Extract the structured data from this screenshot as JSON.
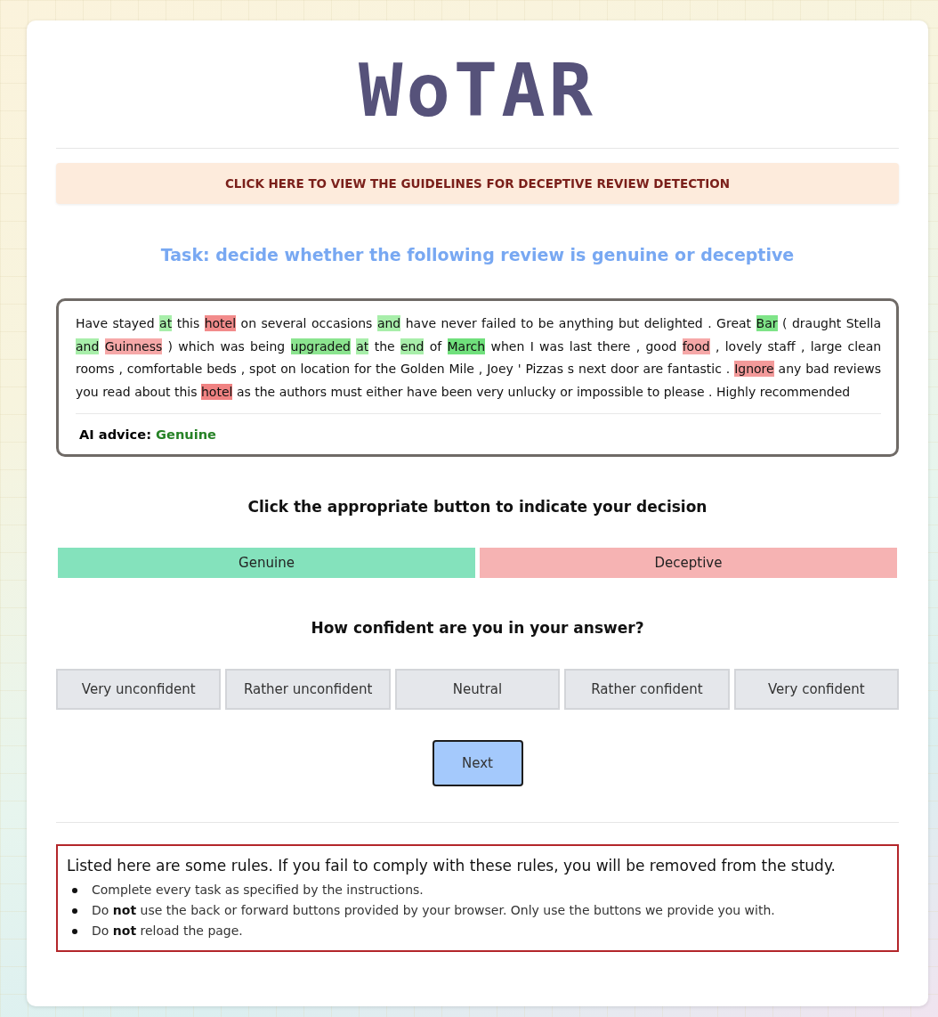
{
  "logo": "WoTAR",
  "guidelines_link": "CLICK HERE TO VIEW THE GUIDELINES FOR DECEPTIVE REVIEW DETECTION",
  "task_heading": "Task: decide whether the following review is genuine or deceptive",
  "review": {
    "segments": [
      {
        "text": "Have stayed"
      },
      {
        "text": "at",
        "color": "#a8eeaa"
      },
      {
        "text": "this"
      },
      {
        "text": "hotel",
        "color": "#f28b8b"
      },
      {
        "text": "on several occasions"
      },
      {
        "text": "and",
        "color": "#a8eeaa"
      },
      {
        "text": "have never failed to be anything but delighted . Great"
      },
      {
        "text": "Bar",
        "color": "#7fe488"
      },
      {
        "text": "( draught Stella"
      },
      {
        "text": "and",
        "color": "#a8eeaa"
      },
      {
        "text": "Guinness",
        "color": "#f6a8a8"
      },
      {
        "text": ") which was being"
      },
      {
        "text": "upgraded",
        "color": "#8be48f"
      },
      {
        "text": "at",
        "color": "#a8eeaa"
      },
      {
        "text": "the"
      },
      {
        "text": "end",
        "color": "#a8eeaa"
      },
      {
        "text": "of"
      },
      {
        "text": "March",
        "color": "#70e07c"
      },
      {
        "text": "when I was last there , good"
      },
      {
        "text": "food",
        "color": "#f6a8a8"
      },
      {
        "text": ", lovely staff , large clean rooms , comfortable beds , spot on location for the Golden Mile , Joey ' Pizzas s next door are fantastic ."
      },
      {
        "text": "Ignore",
        "color": "#f39a9a"
      },
      {
        "text": "any bad reviews you read about this"
      },
      {
        "text": "hotel",
        "color": "#f08282"
      },
      {
        "text": "as the authors must either have been very unlucky or impossible to please . Highly recommended"
      }
    ],
    "advice_label": "AI advice:",
    "advice_value": "Genuine"
  },
  "decision_heading": "Click the appropriate button to indicate your decision",
  "decision_buttons": [
    {
      "label": "Genuine",
      "kind": "genuine"
    },
    {
      "label": "Deceptive",
      "kind": "deceptive"
    }
  ],
  "confidence_heading": "How confident are you in your answer?",
  "confidence_options": [
    {
      "label": "Very unconfident",
      "selected": false
    },
    {
      "label": "Rather unconfident",
      "selected": false
    },
    {
      "label": "Neutral",
      "selected": false
    },
    {
      "label": "Rather confident",
      "selected": false
    },
    {
      "label": "Very confident",
      "selected": false
    }
  ],
  "next_button": "Next",
  "rules": {
    "heading": "Listed here are some rules. If you fail to comply with these rules, you will be removed from the study.",
    "items": [
      "Complete every task as specified by the instructions.",
      "Do **not** use the back or forward buttons provided by your browser. Only use the buttons we provide you with.",
      "Do **not** reload the page."
    ]
  }
}
